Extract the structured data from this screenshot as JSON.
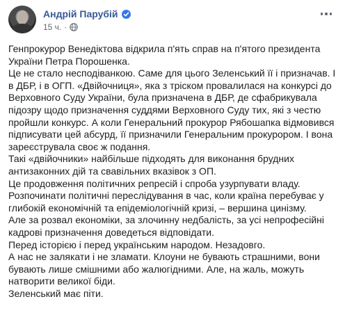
{
  "post": {
    "author": "Андрій Парубій",
    "time": "15 ч.",
    "separator": "·",
    "icons": {
      "verified": "verified-badge-icon",
      "audience": "globe-icon",
      "more": "more-options-icon"
    },
    "colors": {
      "author_link": "#385898",
      "verified": "#3578e5",
      "meta_text": "#606770",
      "body_text": "#1c1e21"
    },
    "paragraphs": [
      "Генпрокурор Венедіктова відкрила п'ять справ на п'ятого президента України Петра Порошенка.",
      "Це не стало несподіванкою. Саме для цього Зеленський її і призначав. І в ДБР, і в ОГП. «Двійочниця», яка з тріском провалилася на конкурсі до Верховного Суду України, була призначена в ДБР, де сфабрикувала підозру щодо призначення суддями Верховного Суду тих, які з честю пройшли конкурс. А коли Генеральний прокурор Рябошапка відмовився підписувати цей абсурд, її призначили Генеральним прокурором. І вона зареєструвала своє ж подання.",
      "Такі «двійочники» найбільше підходять для виконання брудних антизаконних дій та свавільних вказівок з ОП.",
      "Це продовження політичних репресій і спроба узурпувати владу.",
      "Розпочинати політичні переслідування в час, коли країна перебуває у глибокій економічній та епідеміологічній кризі, – вершина цинізму.",
      "Але за розвал економіки, за злочинну недбалість, за усі непрофесійні кадрові призначення доведеться відповідати.",
      "Перед історією і перед українським народом. Незадовго.",
      "А нас не залякати і не зламати. Клоуни не бувають страшними, вони бувають лише смішними або жалюгідними. Але, на жаль, можуть натворити великої біди.",
      "Зеленський має піти."
    ]
  }
}
